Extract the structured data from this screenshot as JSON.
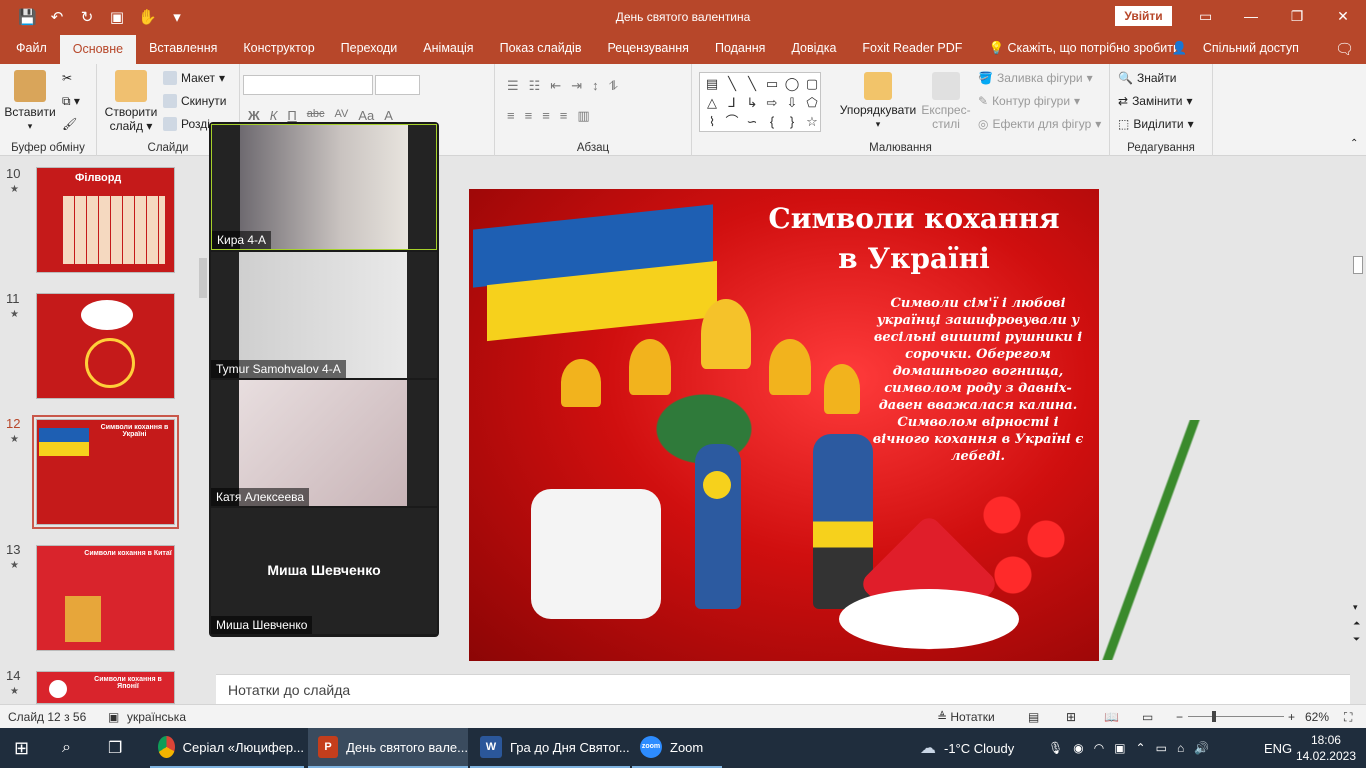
{
  "window": {
    "title": "День святого валентина",
    "signin_label": "Увійти"
  },
  "tabs": [
    "Файл",
    "Основне",
    "Вставлення",
    "Конструктор",
    "Переходи",
    "Анімація",
    "Показ слайдів",
    "Рецензування",
    "Подання",
    "Довідка",
    "Foxit Reader PDF"
  ],
  "tabs_active_index": 1,
  "tell_me": "Скажіть, що потрібно зробити",
  "share": "Спільний доступ",
  "ribbon": {
    "clipboard": {
      "paste": "Вставити",
      "label": "Буфер обміну"
    },
    "slides": {
      "new_slide_line1": "Створити",
      "new_slide_line2": "слайд",
      "layout": "Макет",
      "reset": "Скинути",
      "section": "Розді",
      "label": "Слайди"
    },
    "font": {
      "bold": "Ж",
      "italic": "К",
      "underline": "П",
      "strike": "abc",
      "spacing": "AV",
      "case": "Aa",
      "color": "A"
    },
    "paragraph": {
      "label": "Абзац"
    },
    "drawing": {
      "arrange_line1": "Упорядкувати",
      "styles_line1": "Експрес-",
      "styles_line2": "стилі",
      "fill": "Заливка фігури",
      "outline": "Контур фігури",
      "effects": "Ефекти для фігур",
      "label": "Малювання"
    },
    "editing": {
      "find": "Знайти",
      "replace": "Замінити",
      "select": "Виділити",
      "label": "Редагування"
    }
  },
  "thumbnails": [
    {
      "num": "10",
      "title": "Філворд"
    },
    {
      "num": "11",
      "title": ""
    },
    {
      "num": "12",
      "title": "Символи кохання в Україні"
    },
    {
      "num": "13",
      "title": "Символи кохання в Китаї"
    },
    {
      "num": "14",
      "title": "Символи кохання в Японії"
    }
  ],
  "zoom": {
    "participants": [
      {
        "name": "Кира 4-А"
      },
      {
        "name": "Tymur Samohvalov 4-A"
      },
      {
        "name": "Катя Алексеева"
      },
      {
        "name": "Миша Шевченко",
        "center": "Миша Шевченко"
      }
    ]
  },
  "slide": {
    "title": "Символи кохання в Україні",
    "body": "Символи сім'ї і любові українці зашифровували у весільні вишиті рушники і сорочки. Оберегом домашнього вогнища, символом роду з давніх-давен вважалася калина. Символом вірності і вічного кохання в Україні є лебеді."
  },
  "notes_placeholder": "Нотатки до слайда",
  "status": {
    "slide_counter": "Слайд 12 з 56",
    "language": "українська",
    "notes": "Нотатки",
    "zoom": "62%"
  },
  "taskbar": {
    "items": [
      {
        "label": "Серіал «Люцифер..."
      },
      {
        "label": "День святого вале..."
      },
      {
        "label": "Гра  до Дня Святог..."
      },
      {
        "label": "Zoom"
      }
    ],
    "weather": "-1°C  Cloudy",
    "lang": "ENG",
    "time": "18:06",
    "date": "14.02.2023"
  },
  "colors": {
    "accent": "#b7472a",
    "taskbar": "#1f2d3d"
  }
}
